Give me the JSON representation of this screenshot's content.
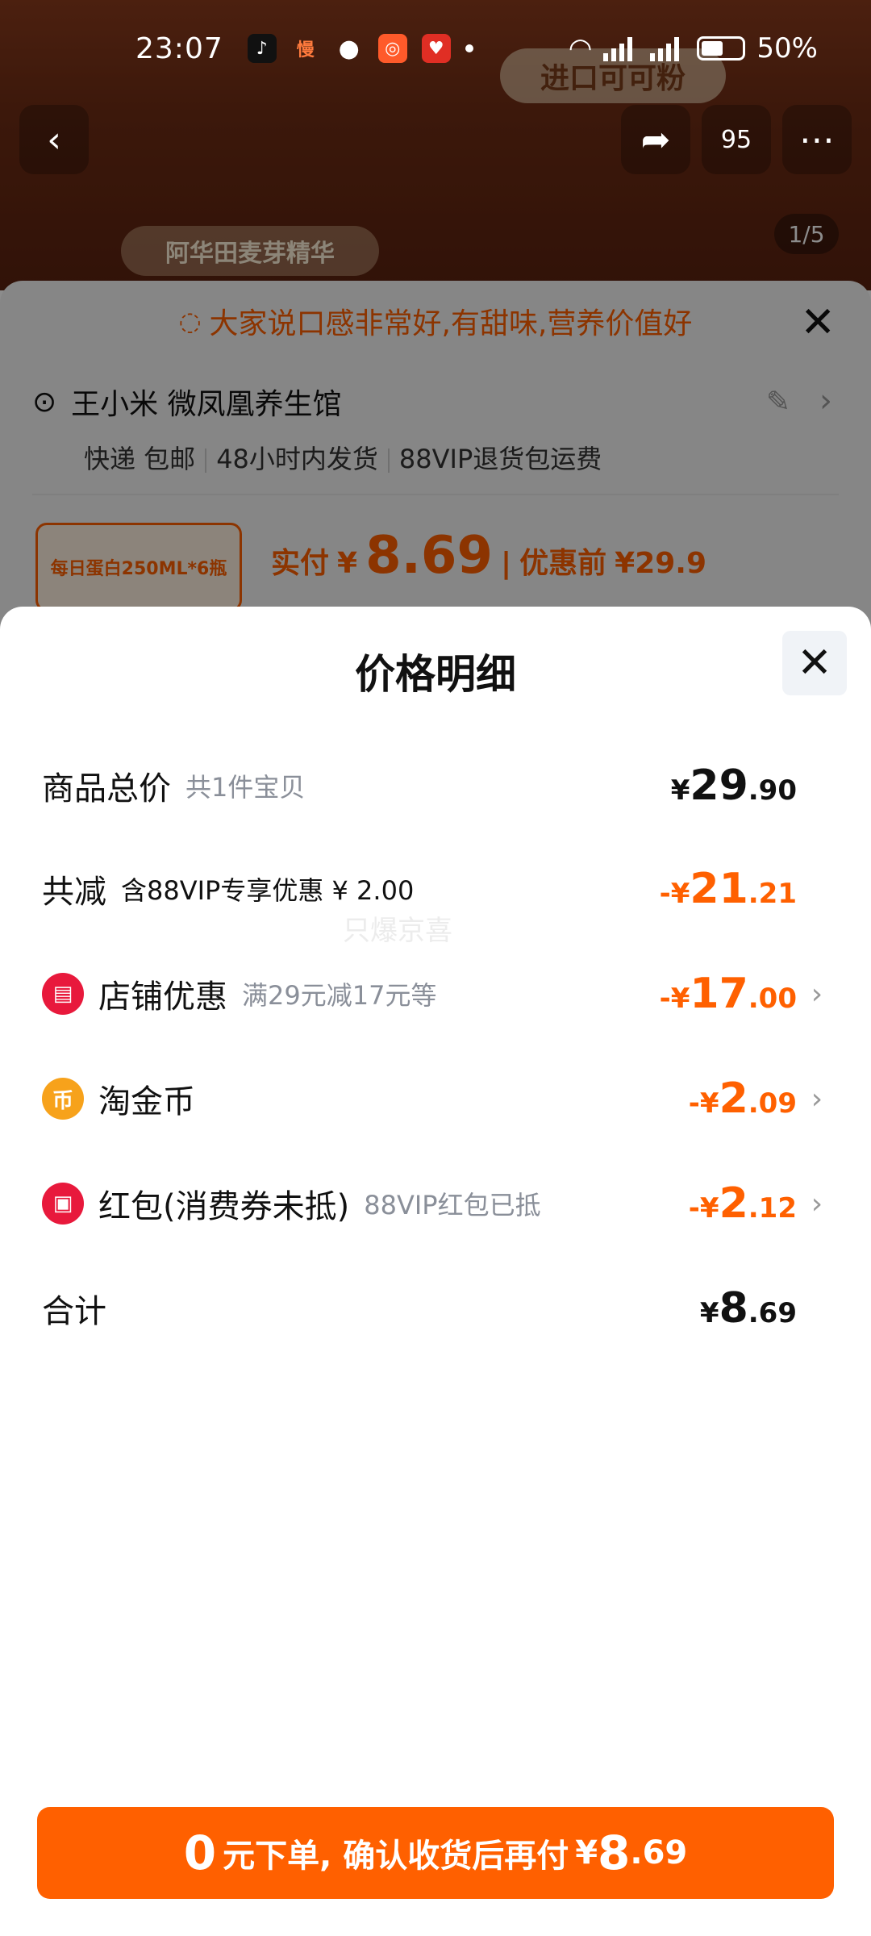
{
  "status_bar": {
    "time": "23:07",
    "battery": "50%",
    "apps": [
      "tiktok-icon",
      "slow-app-icon",
      "wechat-icon",
      "kuaishou-icon",
      "pinduoduo-icon"
    ]
  },
  "hero": {
    "title_badge": "进口可可粉",
    "brand_tag": "阿华田麦芽精华",
    "counter": "1/5",
    "cart_count": "95"
  },
  "underlying_order": {
    "tip": "大家说口感非常好,有甜味,营养价值好",
    "address_line": "王小米 微凤凰养生馆",
    "shipping": [
      "快递 包邮",
      "48小时内发货",
      "88VIP退货包运费"
    ],
    "goods_thumb_text": "每日蛋白250ML*6瓶",
    "paid_label": "实付",
    "paid_currency": "¥",
    "paid_amount": "8.69",
    "before_label": "优惠前",
    "before_amount": "¥29.9"
  },
  "sheet": {
    "title": "价格明细",
    "rows": [
      {
        "label": "商品总价",
        "sub": "共1件宝贝",
        "cur": "¥",
        "int": "29",
        "dec": ".90",
        "negative": false
      },
      {
        "label": "共减",
        "sub": "含88VIP专享优惠 ¥ 2.00",
        "cur": "-¥",
        "int": "21",
        "dec": ".21",
        "negative": true
      },
      {
        "label": "店铺优惠",
        "sub": "满29元减17元等",
        "cur": "-¥",
        "int": "17",
        "dec": ".00",
        "negative": true
      },
      {
        "label": "淘金币",
        "sub": "",
        "cur": "-¥",
        "int": "2",
        "dec": ".09",
        "negative": true
      },
      {
        "label": "红包(消费券未抵)",
        "sub": "88VIP红包已抵",
        "cur": "-¥",
        "int": "2",
        "dec": ".12",
        "negative": true
      },
      {
        "label": "合计",
        "sub": "",
        "cur": "¥",
        "int": "8",
        "dec": ".69",
        "negative": false
      }
    ],
    "watermark": "只爆京喜"
  },
  "cta": {
    "n1": "0",
    "text": "元下单, 确认收货后再付",
    "cur": "¥",
    "n2": "8",
    "d2": ".69"
  },
  "colors": {
    "accent": "#ff6000",
    "store_icon": "#e8193c",
    "coin_icon": "#f7a21b",
    "redpacket_icon": "#e8193c"
  }
}
